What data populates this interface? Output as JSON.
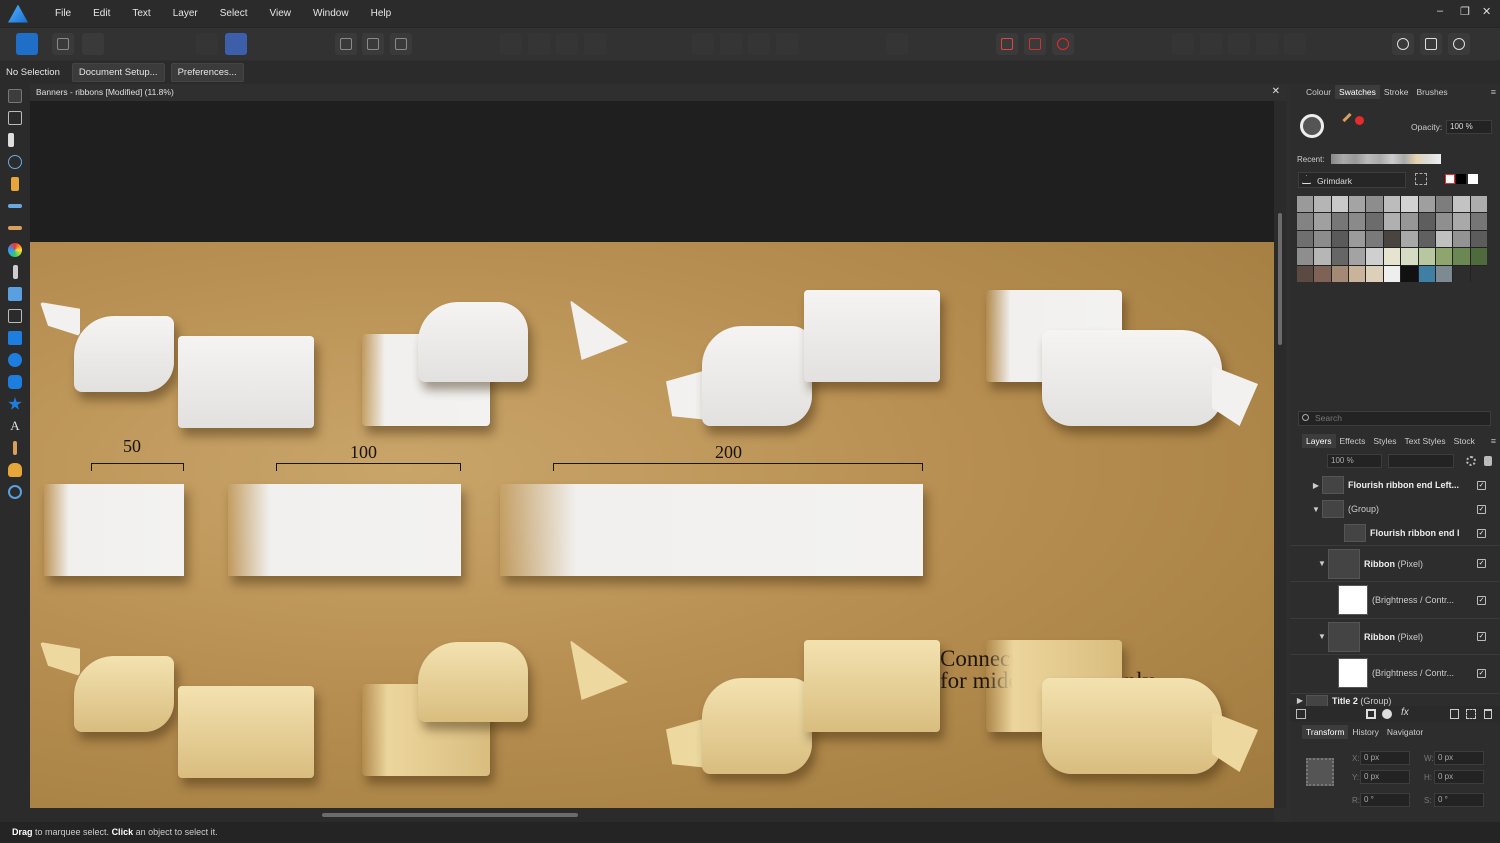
{
  "menubar": {
    "items": [
      "File",
      "Edit",
      "Text",
      "Layer",
      "Select",
      "View",
      "Window",
      "Help"
    ],
    "window_controls": [
      "–",
      "❐",
      "✕"
    ]
  },
  "context": {
    "label": "No Selection",
    "document_setup": "Document Setup...",
    "preferences": "Preferences..."
  },
  "document": {
    "tab_title": "Banners - ribbons [Modified] (11.8%)",
    "close": "✕"
  },
  "canvas": {
    "measures": [
      "50",
      "100",
      "200"
    ],
    "note_line1": "Connecting symbol",
    "note_line2": "for middle section only"
  },
  "colors": {
    "accent_red": "#e52b2b",
    "paper": "#b88f52"
  },
  "swatches_panel": {
    "tabs": [
      "Colour",
      "Swatches",
      "Stroke",
      "Brushes"
    ],
    "active_tab": "Swatches",
    "opacity_label": "Opacity:",
    "opacity_value": "100 %",
    "recent_label": "Recent:",
    "palette_name": "Grimdark",
    "search_placeholder": "Search"
  },
  "layers_panel": {
    "tabs": [
      "Layers",
      "Effects",
      "Styles",
      "Text Styles",
      "Stock"
    ],
    "active_tab": "Layers",
    "opacity_value": "100 %",
    "rows": [
      {
        "name": "Flourish ribbon end Left...",
        "type": ""
      },
      {
        "name": "",
        "type": "(Group)"
      },
      {
        "name": "Flourish ribbon end l",
        "type": ""
      },
      {
        "name": "Ribbon",
        "type": "(Pixel)"
      },
      {
        "name": "",
        "type": "(Brightness / Contr..."
      },
      {
        "name": "Ribbon",
        "type": "(Pixel)"
      },
      {
        "name": "",
        "type": "(Brightness / Contr..."
      },
      {
        "name": "Title 2",
        "type": "(Group)"
      }
    ]
  },
  "transform_panel": {
    "tabs": [
      "Transform",
      "History",
      "Navigator"
    ],
    "active_tab": "Transform",
    "x_label": "X:",
    "x_value": "0 px",
    "y_label": "Y:",
    "y_value": "0 px",
    "w_label": "W:",
    "w_value": "0 px",
    "h_label": "H:",
    "h_value": "0 px",
    "r_label": "R:",
    "r_value": "0 °",
    "s_label": "S:",
    "s_value": "0 °"
  },
  "status": {
    "drag": "Drag",
    "text1": " to marquee select. ",
    "click": "Click",
    "text2": " an object to select it."
  }
}
